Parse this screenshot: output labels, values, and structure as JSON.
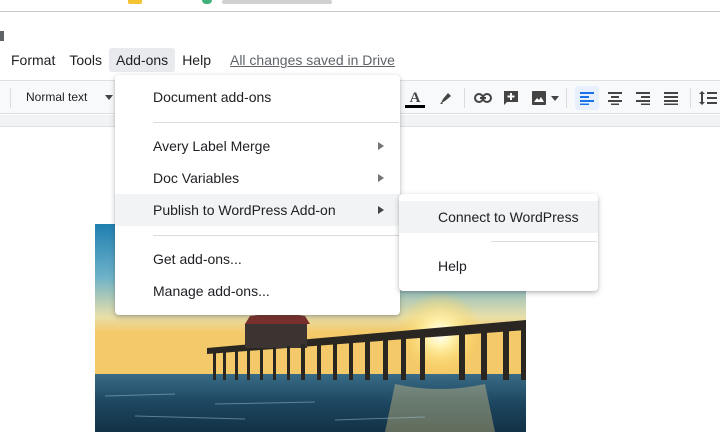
{
  "menubar": {
    "items": [
      "Format",
      "Tools",
      "Add-ons",
      "Help"
    ],
    "open_item": "Add-ons",
    "save_status": "All changes saved in Drive"
  },
  "toolbar": {
    "paragraph_style": "Normal text",
    "text_color": "A",
    "buttons": [
      "text-color",
      "highlight",
      "link",
      "add-comment",
      "insert-image",
      "align-left",
      "align-center",
      "align-right",
      "justify",
      "line-spacing"
    ],
    "active_alignment": "align-left"
  },
  "addons_menu": {
    "items": [
      {
        "label": "Document add-ons",
        "submenu": false
      },
      {
        "label": "Avery Label Merge",
        "submenu": true
      },
      {
        "label": "Doc Variables",
        "submenu": true
      },
      {
        "label": "Publish to WordPress Add-on",
        "submenu": true,
        "highlighted": true
      },
      {
        "label": "Get add-ons...",
        "submenu": false
      },
      {
        "label": "Manage add-ons...",
        "submenu": false
      }
    ]
  },
  "wordpress_submenu": {
    "items": [
      {
        "label": "Connect to WordPress",
        "highlighted": true
      },
      {
        "label": "Help"
      }
    ]
  },
  "colors": {
    "accent_blue": "#1a73e8",
    "menu_hover": "#f1f3f4",
    "toolbar_bg": "#f8f9fa"
  }
}
